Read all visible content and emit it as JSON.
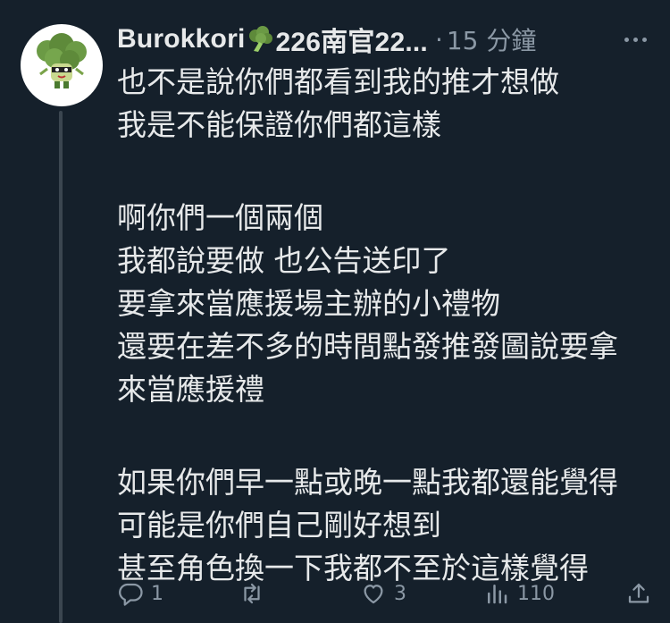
{
  "tweet": {
    "display_name": "Burokkori",
    "name_suffix": "226南官22...",
    "separator": "·",
    "timestamp": "15 分鐘",
    "body_lines": [
      "也不是說你們都看到我的推才想做",
      "我是不能保證你們都這樣",
      "",
      "啊你們一個兩個",
      "我都說要做 也公告送印了",
      "要拿來當應援場主辦的小禮物",
      "還要在差不多的時間點發推發圖說要拿",
      "來當應援禮",
      "",
      "如果你們早一點或晚一點我都還能覺得",
      "可能是你們自己剛好想到",
      "甚至角色換一下我都不至於這樣覺得"
    ],
    "actions": {
      "reply_count": "1",
      "retweet_count": "",
      "like_count": "3",
      "views_count": "110"
    },
    "icons": {
      "name_emoji": "broccoli-icon",
      "more": "more-icon",
      "reply": "reply-icon",
      "retweet": "retweet-icon",
      "like": "heart-icon",
      "views": "views-icon",
      "share": "share-icon"
    }
  },
  "colors": {
    "background": "#15202b",
    "text": "#e7e9ea",
    "muted": "#8b98a5",
    "thread_line": "#3b4650",
    "broccoli": "#5e8a3a"
  }
}
